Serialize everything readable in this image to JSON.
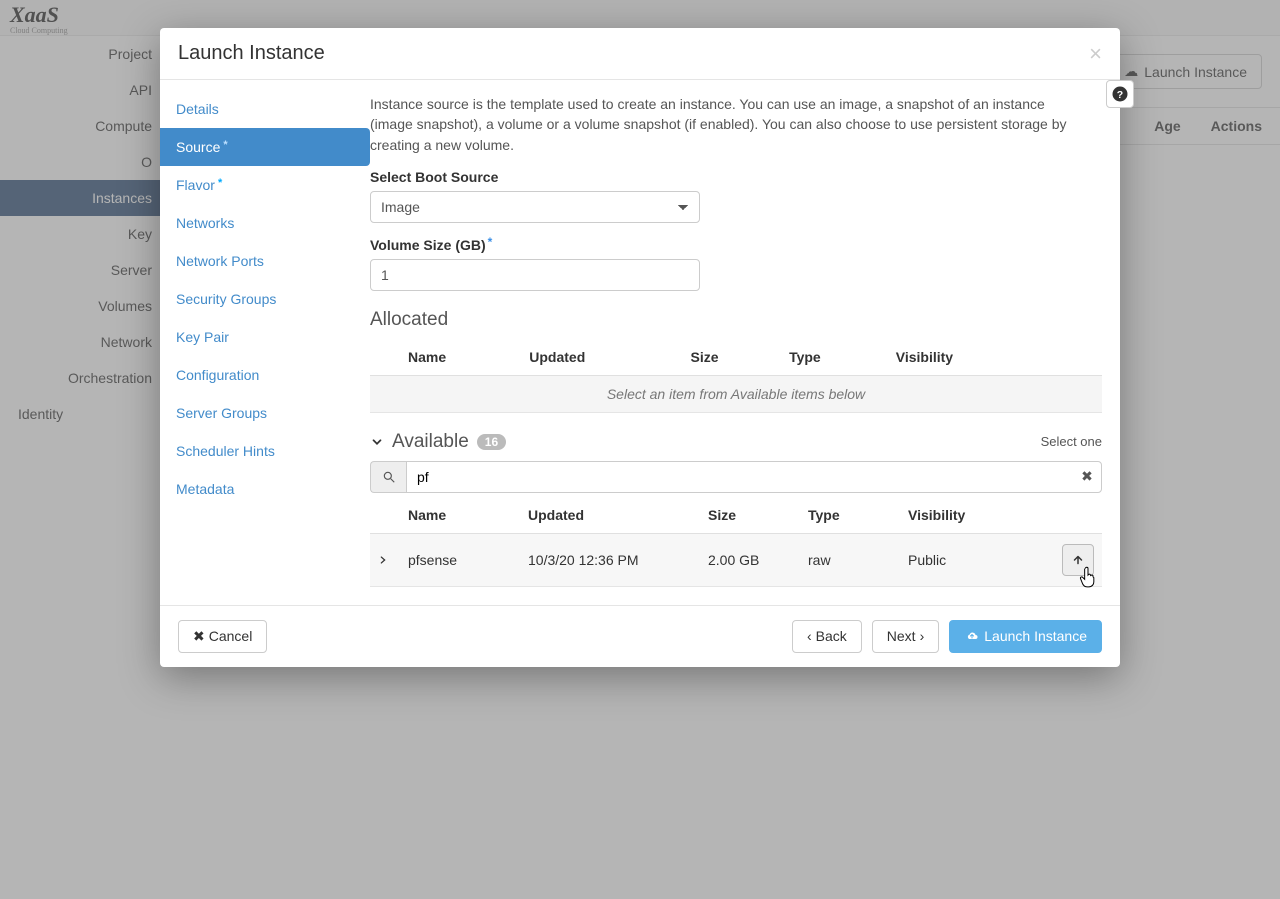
{
  "background": {
    "logo_main": "XaaS",
    "logo_sub": "Cloud Computing",
    "sidebar": [
      "Project",
      "API",
      "Compute",
      "O",
      "Instances",
      "Key",
      "Server",
      "Volumes",
      "Network",
      "Orchestration",
      "Identity"
    ],
    "sidebar_active_index": 4,
    "launch_button": "Launch Instance",
    "table_cols": [
      "Age",
      "Actions"
    ]
  },
  "modal": {
    "title": "Launch Instance",
    "steps": [
      {
        "label": "Details",
        "required": false
      },
      {
        "label": "Source",
        "required": true,
        "active": true
      },
      {
        "label": "Flavor",
        "required": true
      },
      {
        "label": "Networks",
        "required": false
      },
      {
        "label": "Network Ports",
        "required": false
      },
      {
        "label": "Security Groups",
        "required": false
      },
      {
        "label": "Key Pair",
        "required": false
      },
      {
        "label": "Configuration",
        "required": false
      },
      {
        "label": "Server Groups",
        "required": false
      },
      {
        "label": "Scheduler Hints",
        "required": false
      },
      {
        "label": "Metadata",
        "required": false
      }
    ],
    "description": "Instance source is the template used to create an instance. You can use an image, a snapshot of an instance (image snapshot), a volume or a volume snapshot (if enabled). You can also choose to use persistent storage by creating a new volume.",
    "boot_label": "Select Boot Source",
    "boot_value": "Image",
    "vol_label": "Volume Size (GB)",
    "vol_value": "1",
    "allocated": {
      "title": "Allocated",
      "columns": [
        "Name",
        "Updated",
        "Size",
        "Type",
        "Visibility"
      ],
      "empty": "Select an item from Available items below"
    },
    "available": {
      "title": "Available",
      "count": "16",
      "hint": "Select one",
      "filter": "pf",
      "columns": [
        "Name",
        "Updated",
        "Size",
        "Type",
        "Visibility"
      ],
      "rows": [
        {
          "name": "pfsense",
          "updated": "10/3/20 12:36 PM",
          "size": "2.00 GB",
          "type": "raw",
          "visibility": "Public"
        }
      ]
    },
    "footer": {
      "cancel": "Cancel",
      "back": "Back",
      "next": "Next",
      "launch": "Launch Instance"
    }
  }
}
